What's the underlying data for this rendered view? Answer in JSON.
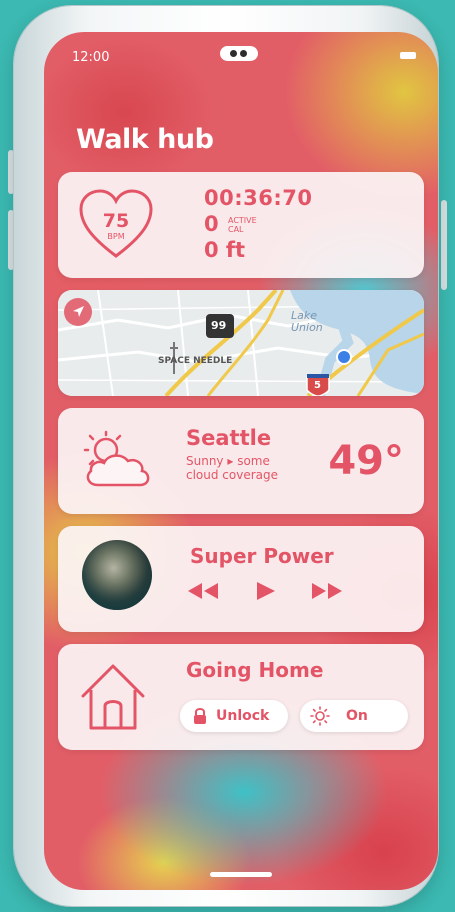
{
  "status_bar": {
    "time": "12:00"
  },
  "app": {
    "title": "Walk hub"
  },
  "walk": {
    "heart_rate": "75",
    "heart_rate_unit": "BPM",
    "duration": "00:36:70",
    "active_cal": "0",
    "active_cal_label_line1": "ACTIVE",
    "active_cal_label_line2": "CAL",
    "distance": "0 ft"
  },
  "map": {
    "landmark_label": "SPACE NEEDLE",
    "lake_label_line1": "Lake",
    "lake_label_line2": "Union",
    "highway_99": "99",
    "interstate_5": "5",
    "locate_icon": "navigation-arrow-icon"
  },
  "weather": {
    "city": "Seattle",
    "condition": "Sunny ▸ some cloud coverage",
    "temperature": "49°",
    "icon": "partly-cloudy-icon"
  },
  "music": {
    "song_title": "Super Power",
    "controls": [
      "rewind-icon",
      "play-icon",
      "fast-forward-icon"
    ]
  },
  "home": {
    "scene_title": "Going Home",
    "unlock_label": "Unlock",
    "lights_label": "On",
    "icon": "house-icon"
  },
  "colors": {
    "accent": "#e35566",
    "background": "#3bb9b2"
  }
}
